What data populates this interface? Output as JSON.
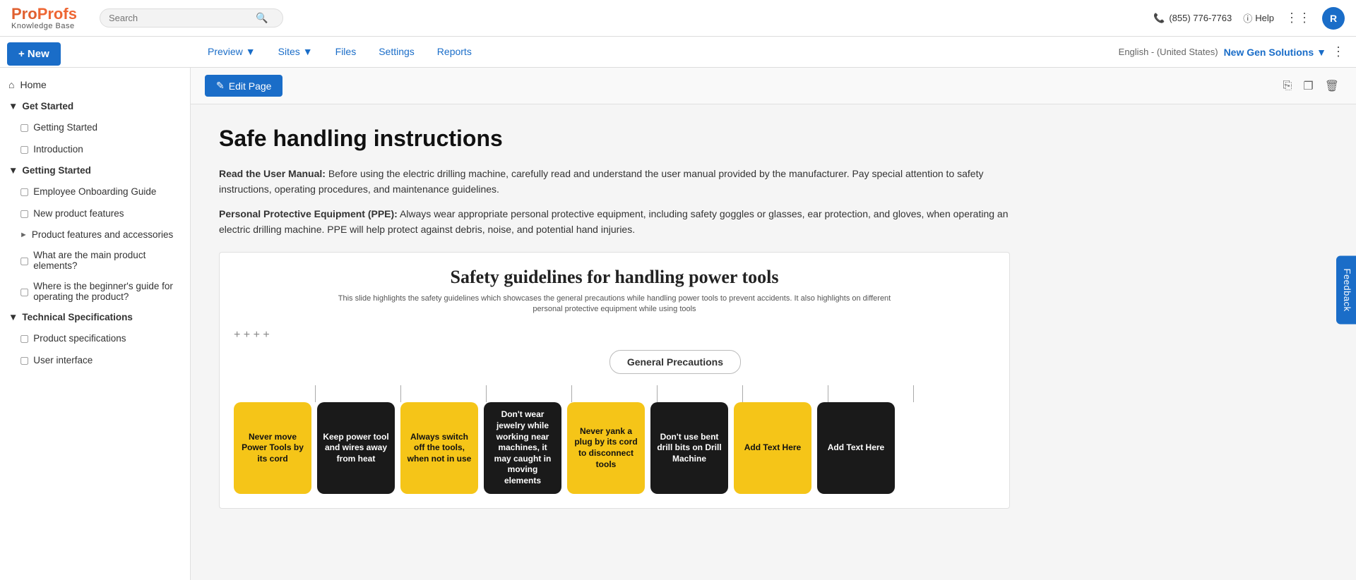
{
  "logo": {
    "brand": "ProProfs",
    "sub": "Knowledge Base"
  },
  "search": {
    "placeholder": "Search"
  },
  "topnav": {
    "phone": "(855) 776-7763",
    "help": "Help",
    "avatar": "R"
  },
  "secondnav": {
    "items": [
      {
        "label": "Preview",
        "hasChevron": true
      },
      {
        "label": "Sites",
        "hasChevron": true
      },
      {
        "label": "Files",
        "hasChevron": false
      },
      {
        "label": "Settings",
        "hasChevron": false
      },
      {
        "label": "Reports",
        "hasChevron": false
      }
    ],
    "lang": "English - (United States)",
    "siteName": "New Gen Solutions"
  },
  "newBtn": "+ New",
  "sidebar": {
    "home": "Home",
    "sections": [
      {
        "type": "section",
        "label": "Get Started",
        "expanded": true,
        "items": [
          {
            "label": "Getting Started",
            "indent": 1
          },
          {
            "label": "Introduction",
            "indent": 1
          }
        ]
      },
      {
        "type": "section",
        "label": "Getting Started",
        "expanded": true,
        "items": [
          {
            "label": "Employee Onboarding Guide",
            "indent": 1
          },
          {
            "label": "New product features",
            "indent": 1
          },
          {
            "label": "Product features and accessories",
            "indent": 1,
            "hasChevron": true
          },
          {
            "label": "What are the main product elements?",
            "indent": 1
          },
          {
            "label": "Where is the beginner's guide for operating the product?",
            "indent": 1
          }
        ]
      },
      {
        "type": "section",
        "label": "Technical Specifications",
        "expanded": true,
        "items": [
          {
            "label": "Product specifications",
            "indent": 1
          },
          {
            "label": "User interface",
            "indent": 1
          }
        ]
      }
    ]
  },
  "editBar": {
    "editPageBtn": "Edit Page"
  },
  "content": {
    "title": "Safe handling instructions",
    "para1bold": "Read the User Manual:",
    "para1text": " Before using the electric drilling machine, carefully read and understand the user manual provided by the manufacturer. Pay special attention to safety instructions, operating procedures, and maintenance guidelines.",
    "para2bold": "Personal Protective Equipment (PPE):",
    "para2text": " Always wear appropriate personal protective equipment, including safety goggles or glasses, ear protection, and gloves, when operating an electric drilling machine. PPE will help protect against debris, noise, and potential hand injuries."
  },
  "slide": {
    "title": "Safety guidelines for handling power tools",
    "subtitle": "This slide highlights the safety guidelines which showcases the general precautions while handling power tools to prevent accidents. It also highlights on different personal protective equipment while using tools",
    "precautions": "General Precautions",
    "cards": [
      {
        "text": "Never move Power Tools by its cord",
        "color": "yellow"
      },
      {
        "text": "Keep power tool and wires away from heat",
        "color": "black"
      },
      {
        "text": "Always switch off the tools, when not in use",
        "color": "yellow"
      },
      {
        "text": "Don't wear jewelry while working near machines, it may caught in moving elements",
        "color": "black"
      },
      {
        "text": "Never yank a plug by its cord to disconnect tools",
        "color": "yellow"
      },
      {
        "text": "Don't use bent drill bits on Drill Machine",
        "color": "black"
      },
      {
        "text": "Add Text Here",
        "color": "yellow"
      },
      {
        "text": "Add Text Here",
        "color": "black"
      }
    ]
  },
  "feedback": "Feedback"
}
